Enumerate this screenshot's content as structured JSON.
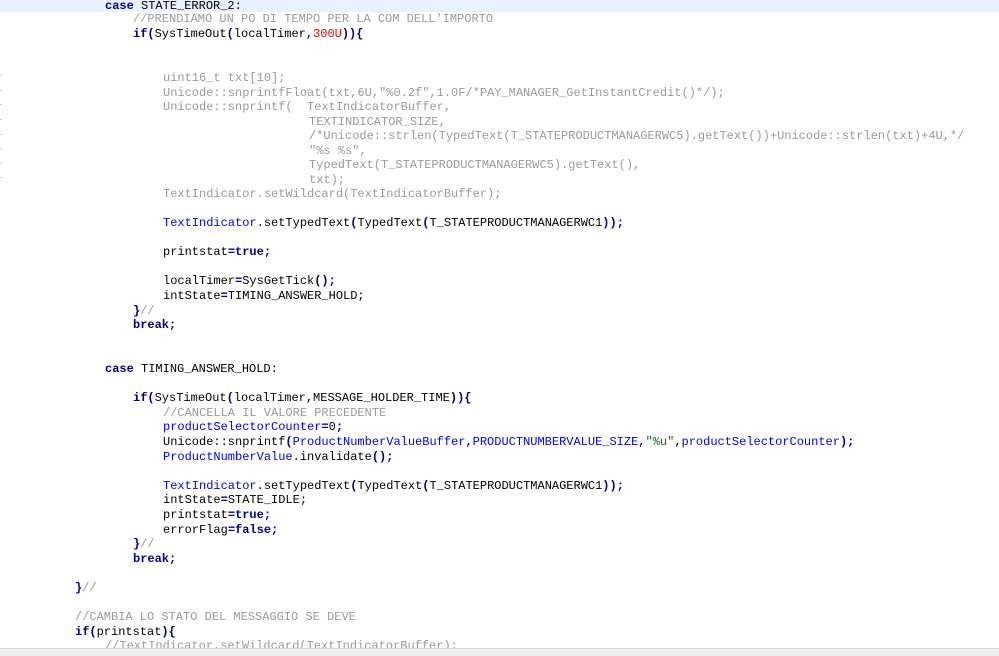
{
  "editor": {
    "lines": [
      {
        "segments": [
          {
            "t": "case",
            "c": "kw"
          },
          {
            "t": " STATE_ERROR_2:",
            "c": ""
          }
        ]
      },
      {
        "segments": [
          {
            "t": "//PRENDIAMO UN PO DI TEMPO PER LA COM DELL'IMPORTO",
            "c": "dis"
          }
        ]
      },
      {
        "segments": [
          {
            "t": "if",
            "c": "kw"
          },
          {
            "t": "(",
            "c": "kw"
          },
          {
            "t": "SysTimeOut",
            "c": ""
          },
          {
            "t": "(",
            "c": "kw"
          },
          {
            "t": "localTimer,",
            "c": ""
          },
          {
            "t": "300U",
            "c": "num"
          },
          {
            "t": ")){",
            "c": "kw"
          }
        ]
      },
      {
        "segments": [
          {
            "t": "uint16_t txt[10];",
            "c": "dis"
          }
        ]
      },
      {
        "segments": [
          {
            "t": "Unicode::snprintfFloat(txt,6U,\"%0.2f\",1.0F/*PAY_MANAGER_GetInstantCredit()*/);",
            "c": "dis"
          }
        ]
      },
      {
        "segments": [
          {
            "t": "Unicode::snprintf(  TextIndicatorBuffer,",
            "c": "dis"
          }
        ]
      },
      {
        "segments": [
          {
            "t": "TEXTINDICATOR_SIZE,",
            "c": "dis"
          }
        ]
      },
      {
        "segments": [
          {
            "t": "/*Unicode::strlen(TypedText(T_STATEPRODUCTMANAGERWC5).getText())+Unicode::strlen(txt)+4U,*/",
            "c": "dis"
          }
        ]
      },
      {
        "segments": [
          {
            "t": "\"%s %s\",",
            "c": "dis"
          }
        ]
      },
      {
        "segments": [
          {
            "t": "TypedText(T_STATEPRODUCTMANAGERWC5).getText(),",
            "c": "dis"
          }
        ]
      },
      {
        "segments": [
          {
            "t": "txt);",
            "c": "dis"
          }
        ]
      },
      {
        "segments": [
          {
            "t": "TextIndicator.setWildcard(TextIndicatorBuffer);",
            "c": "dis"
          }
        ]
      },
      {
        "segments": [
          {
            "t": "TextIndicator",
            "c": "blue"
          },
          {
            "t": ".setTypedText",
            "c": ""
          },
          {
            "t": "(",
            "c": "kw"
          },
          {
            "t": "TypedText",
            "c": ""
          },
          {
            "t": "(",
            "c": "kw"
          },
          {
            "t": "T_STATEPRODUCTMANAGERWC1",
            "c": ""
          },
          {
            "t": "));",
            "c": "kw"
          }
        ]
      },
      {
        "segments": [
          {
            "t": "printstat",
            "c": ""
          },
          {
            "t": "=",
            "c": "kw"
          },
          {
            "t": "true",
            "c": "kw"
          },
          {
            "t": ";",
            "c": "kw"
          }
        ]
      },
      {
        "segments": [
          {
            "t": "localTimer",
            "c": ""
          },
          {
            "t": "=",
            "c": "kw"
          },
          {
            "t": "SysGetTick",
            "c": ""
          },
          {
            "t": "();",
            "c": "kw"
          }
        ]
      },
      {
        "segments": [
          {
            "t": "intState",
            "c": ""
          },
          {
            "t": "=",
            "c": "kw"
          },
          {
            "t": "TIMING_ANSWER_HOLD;",
            "c": ""
          }
        ]
      },
      {
        "segments": [
          {
            "t": "}",
            "c": "kw"
          },
          {
            "t": "//",
            "c": "dis"
          }
        ]
      },
      {
        "segments": [
          {
            "t": "break",
            "c": "kw"
          },
          {
            "t": ";",
            "c": "kw"
          }
        ]
      },
      {
        "segments": [
          {
            "t": "case",
            "c": "kw"
          },
          {
            "t": " TIMING_ANSWER_HOLD:",
            "c": ""
          }
        ]
      },
      {
        "segments": [
          {
            "t": "if",
            "c": "kw"
          },
          {
            "t": "(",
            "c": "kw"
          },
          {
            "t": "SysTimeOut",
            "c": ""
          },
          {
            "t": "(",
            "c": "kw"
          },
          {
            "t": "localTimer,MESSAGE_HOLDER_TIME",
            "c": ""
          },
          {
            "t": ")){",
            "c": "kw"
          }
        ]
      },
      {
        "segments": [
          {
            "t": "//CANCELLA IL VALORE PRECEDENTE",
            "c": "dis"
          }
        ]
      },
      {
        "segments": [
          {
            "t": "productSelectorCounter",
            "c": "blue"
          },
          {
            "t": "=",
            "c": "kw"
          },
          {
            "t": "0",
            "c": ""
          },
          {
            "t": ";",
            "c": "kw"
          }
        ]
      },
      {
        "segments": [
          {
            "t": "Unicode::snprintf",
            "c": ""
          },
          {
            "t": "(",
            "c": "kw"
          },
          {
            "t": "ProductNumberValueBuffer",
            "c": "blue"
          },
          {
            "t": ",",
            "c": ""
          },
          {
            "t": "PRODUCTNUMBERVALUE_SIZE",
            "c": "blue"
          },
          {
            "t": ",",
            "c": ""
          },
          {
            "t": "\"%u\"",
            "c": "green"
          },
          {
            "t": ",",
            "c": ""
          },
          {
            "t": "productSelectorCounter",
            "c": "blue"
          },
          {
            "t": ");",
            "c": "kw"
          }
        ]
      },
      {
        "segments": [
          {
            "t": "ProductNumberValue",
            "c": "blue"
          },
          {
            "t": ".invalidate",
            "c": ""
          },
          {
            "t": "();",
            "c": "kw"
          }
        ]
      },
      {
        "segments": [
          {
            "t": "TextIndicator",
            "c": "blue"
          },
          {
            "t": ".setTypedText",
            "c": ""
          },
          {
            "t": "(",
            "c": "kw"
          },
          {
            "t": "TypedText",
            "c": ""
          },
          {
            "t": "(",
            "c": "kw"
          },
          {
            "t": "T_STATEPRODUCTMANAGERWC1",
            "c": ""
          },
          {
            "t": "));",
            "c": "kw"
          }
        ]
      },
      {
        "segments": [
          {
            "t": "intState",
            "c": ""
          },
          {
            "t": "=",
            "c": "kw"
          },
          {
            "t": "STATE_IDLE;",
            "c": ""
          }
        ]
      },
      {
        "segments": [
          {
            "t": "printstat",
            "c": ""
          },
          {
            "t": "=",
            "c": "kw"
          },
          {
            "t": "true",
            "c": "kw"
          },
          {
            "t": ";",
            "c": "kw"
          }
        ]
      },
      {
        "segments": [
          {
            "t": "errorFlag",
            "c": ""
          },
          {
            "t": "=",
            "c": "kw"
          },
          {
            "t": "false",
            "c": "kw"
          },
          {
            "t": ";",
            "c": "kw"
          }
        ]
      },
      {
        "segments": [
          {
            "t": "}",
            "c": "kw"
          },
          {
            "t": "//",
            "c": "dis"
          }
        ]
      },
      {
        "segments": [
          {
            "t": "break",
            "c": "kw"
          },
          {
            "t": ";",
            "c": "kw"
          }
        ]
      },
      {
        "segments": [
          {
            "t": "}",
            "c": "kw"
          },
          {
            "t": "//",
            "c": "dis"
          }
        ]
      },
      {
        "segments": [
          {
            "t": "//CAMBIA LO STATO DEL MESSAGGIO SE DEVE",
            "c": "dis"
          }
        ]
      },
      {
        "segments": [
          {
            "t": "if",
            "c": "kw"
          },
          {
            "t": "(",
            "c": "kw"
          },
          {
            "t": "printstat",
            "c": ""
          },
          {
            "t": "){",
            "c": "kw"
          }
        ]
      },
      {
        "segments": [
          {
            "t": "//TextIndicator.setWildcard(TextIndicatorBuffer);",
            "c": "dis"
          }
        ]
      }
    ]
  }
}
